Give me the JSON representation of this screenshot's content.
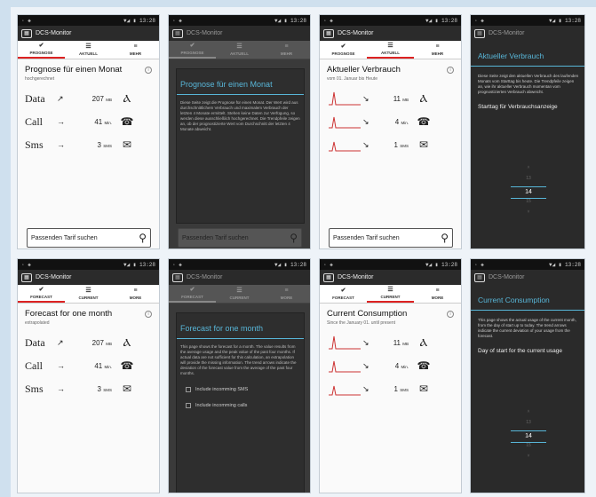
{
  "status": {
    "left": "◦ ◈",
    "right": "▼◢ ▮ 13:28"
  },
  "app_title": "DCS-Monitor",
  "de": {
    "tabs": [
      {
        "label": "PROGNOSE",
        "icon": "✔"
      },
      {
        "label": "AKTUELL",
        "icon": "☰"
      },
      {
        "label": "MEHR",
        "icon": "≡"
      }
    ],
    "forecast_title": "Prognose für einen Monat",
    "forecast_sub": "hochgerechnet",
    "forecast_rows": [
      {
        "label": "Data",
        "arrow": "↗",
        "value": "207",
        "unit": "MB",
        "icon": "antenna-icon",
        "glyph": "Ⲁ"
      },
      {
        "label": "Call",
        "arrow": "→",
        "value": "41",
        "unit": "Min.",
        "icon": "phone-icon",
        "glyph": "☎"
      },
      {
        "label": "Sms",
        "arrow": "→",
        "value": "3",
        "unit": "SMS",
        "icon": "envelope-icon",
        "glyph": "✉"
      }
    ],
    "tariff_button": "Passenden Tarif suchen",
    "forecast_dialog_title": "Prognose für einen Monat",
    "forecast_dialog_text": "Diese Seite zeigt die Prognose für einen Monat. Der Wert wird aus durchschnittlichem Verbrauch und maximalem Verbrauch der letzten 4 Monate ermittelt. Stehen keine Daten zur Verfügung, so werden diese ausschließlich hochgerechnet. Die Trendpfeile zeigen an, ob der prognostizierte Wert vom Durchschnitt der letzten 4 Monate abweicht.",
    "current_title": "Aktueller Verbrauch",
    "current_sub": "vom 01. Januar bis Heute",
    "current_rows": [
      {
        "arrow": "↘",
        "value": "11",
        "unit": "MB",
        "glyph": "Ⲁ"
      },
      {
        "arrow": "↘",
        "value": "4",
        "unit": "Min.",
        "glyph": "☎"
      },
      {
        "arrow": "↘",
        "value": "1",
        "unit": "SMS",
        "glyph": "✉"
      }
    ],
    "current_dialog_title": "Aktueller Verbrauch",
    "current_dialog_text": "Diese Seite zeigt den aktuellen Verbrauch des laufenden Monats vom Starttag bis heute. Die Trendpfeile zeigen an, wie ihr aktueller Verbrauch momentan vom prognostizierten Verbrauch abweicht.",
    "current_dialog_start": "Starttag für Verbrauchsanzeige",
    "picker": [
      "13",
      "14",
      "15"
    ]
  },
  "en": {
    "tabs": [
      {
        "label": "FORECAST",
        "icon": "✔"
      },
      {
        "label": "CURRENT",
        "icon": "☰"
      },
      {
        "label": "MORE",
        "icon": "≡"
      }
    ],
    "forecast_title": "Forecast for one month",
    "forecast_sub": "extrapolated",
    "forecast_rows": [
      {
        "label": "Data",
        "arrow": "↗",
        "value": "207",
        "unit": "MB",
        "glyph": "Ⲁ"
      },
      {
        "label": "Call",
        "arrow": "→",
        "value": "41",
        "unit": "Min.",
        "glyph": "☎"
      },
      {
        "label": "Sms",
        "arrow": "→",
        "value": "3",
        "unit": "SMS",
        "glyph": "✉"
      }
    ],
    "forecast_dialog_title": "Forecast for one month",
    "forecast_dialog_text": "This page shows the forecast for a month. The value results from the average usage and the peak value of the past four months. If actual data are not sufficient for this calculation, an extrapolation will provide the missing information. The trend arrows indicate the deviation of the forecast value from the average of the past four months.",
    "forecast_dialog_check1": "Include incomming SMS",
    "forecast_dialog_check2": "Include incomming calls",
    "current_title": "Current Consumption",
    "current_sub": "Since the January 01. until present",
    "current_rows": [
      {
        "arrow": "↘",
        "value": "11",
        "unit": "MB",
        "glyph": "Ⲁ"
      },
      {
        "arrow": "↘",
        "value": "4",
        "unit": "Min.",
        "glyph": "☎"
      },
      {
        "arrow": "↘",
        "value": "1",
        "unit": "SMS",
        "glyph": "✉"
      }
    ],
    "current_dialog_title": "Current Consumption",
    "current_dialog_text": "This page shows the actual usage of the current month, from the day of start up to today. The trend arrows indicate the current deviation of your usage from the forecast.",
    "current_dialog_start": "Day of start for the current usage",
    "picker": [
      "13",
      "14",
      "15"
    ]
  }
}
